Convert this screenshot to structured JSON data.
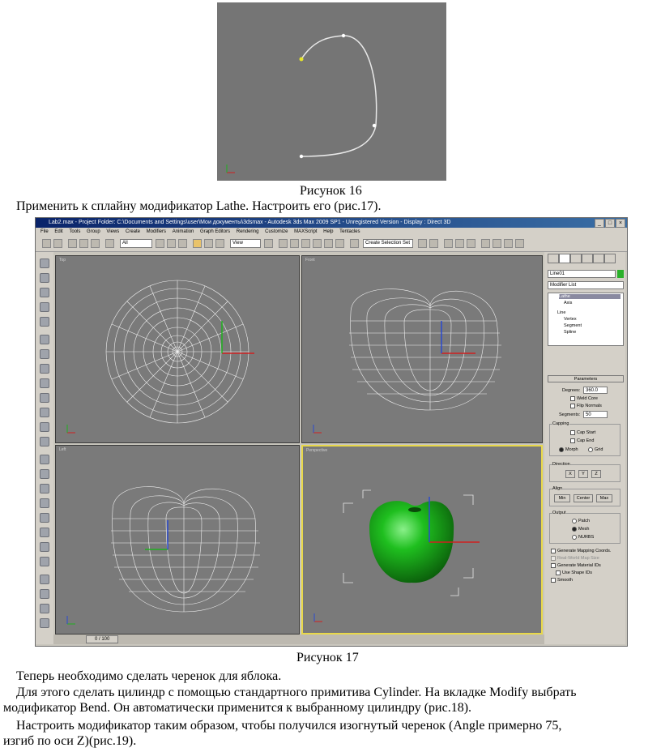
{
  "figure16": {
    "caption": "Рисунок 16"
  },
  "intro_line": "Применить к сплайну модификатор Lathe. Настроить его (рис.17).",
  "max_window": {
    "title": "Lab2.max    - Project Folder: C:\\Documents and Settings\\user\\Мои документы\\3dsmax    - Autodesk 3ds Max  2009 SP1    - Unregistered Version    - Display : Direct 3D",
    "menu": [
      "File",
      "Edit",
      "Tools",
      "Group",
      "Views",
      "Create",
      "Modifiers",
      "Animation",
      "Graph Editors",
      "Rendering",
      "Customize",
      "MAXScript",
      "Help",
      "Tentacles"
    ],
    "selection_filter": "All",
    "ref_coord": "View",
    "named_selection": "Create Selection Set",
    "viewports": {
      "top": "Top",
      "front": "Front",
      "left": "Left",
      "perspective": "Perspective"
    },
    "command_panel": {
      "object_name": "Line01",
      "modifier_list": "Modifier List",
      "stack": [
        "Lathe",
        "Axis",
        "Line",
        "Vertex",
        "Segment",
        "Spline"
      ],
      "rollout_title": "Parameters",
      "degrees_label": "Degrees:",
      "degrees_value": "360.0",
      "weld_core": "Weld Core",
      "flip_normals": "Flip Normals",
      "segments_label": "Segments:",
      "segments_value": "50",
      "capping_label": "Capping",
      "cap_start": "Cap Start",
      "cap_end": "Cap End",
      "morph": "Morph",
      "grid": "Grid",
      "direction_label": "Direction",
      "dir_x": "X",
      "dir_y": "Y",
      "dir_z": "Z",
      "align_label": "Align",
      "align_min": "Min",
      "align_center": "Center",
      "align_max": "Max",
      "output_label": "Output",
      "patch": "Patch",
      "mesh": "Mesh",
      "nurbs": "NURBS",
      "gen_mapping": "Generate Mapping Coords.",
      "real_world": "Real-World Map Size",
      "gen_material": "Generate Material IDs",
      "use_shape": "Use Shape IDs",
      "smooth": "Smooth"
    },
    "timeline": "0 / 100"
  },
  "figure17": {
    "caption": "Рисунок 17"
  },
  "paragraphs": [
    "Теперь необходимо сделать черенок для яблока.",
    "Для этого сделать цилиндр с помощью стандартного примитива Cylinder. На вкладке Modify выбрать",
    "модификатор Bend. Он автоматически применится к выбранному цилиндру (рис.18).",
    "Настроить модификатор таким образом, чтобы получился изогнутый черенок (Angle примерно 75,",
    "изгиб по оси Z)(рис.19)."
  ],
  "colors": {
    "viewport_bg": "#7a7a7a",
    "apple_green": "#1fbf1f",
    "active_border": "#e8d84a"
  }
}
